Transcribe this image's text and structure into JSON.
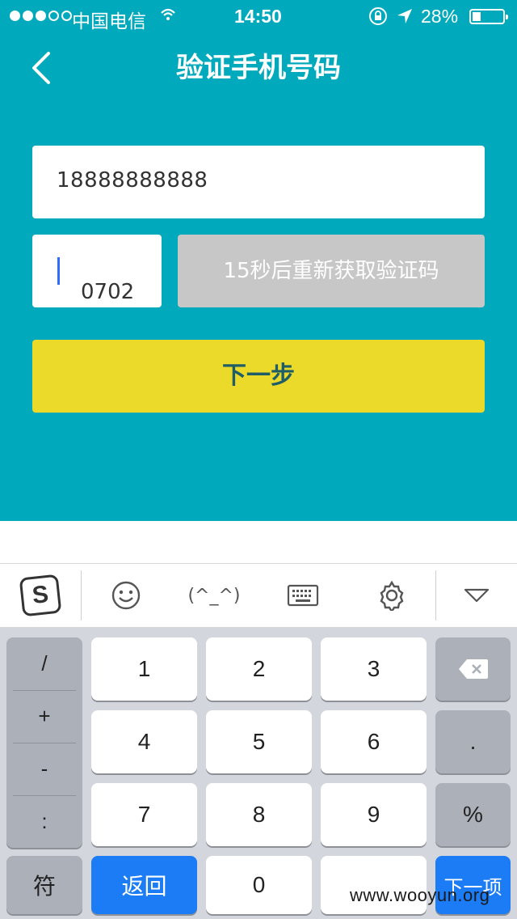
{
  "status_bar": {
    "carrier": "中国电信",
    "time": "14:50",
    "battery_percent": "28%",
    "battery_level": 0.28
  },
  "nav": {
    "title": "验证手机号码",
    "back_icon": "chevron-left-icon"
  },
  "form": {
    "phone_value": "18888888888",
    "code_value": "0702",
    "resend_label": "15秒后重新获取验证码",
    "next_label": "下一步"
  },
  "keyboard_toolbar": {
    "logo_letter": "S",
    "emoji_icon": "smiley-icon",
    "kaomoji": "(^_^)",
    "keyboard_icon": "keyboard-icon",
    "settings_icon": "gear-icon",
    "hide_icon": "triangle-down-icon"
  },
  "keyboard": {
    "symbols": [
      "/",
      "+",
      "-",
      ":"
    ],
    "digits": [
      "1",
      "2",
      "3",
      "4",
      "5",
      "6",
      "7",
      "8",
      "9"
    ],
    "delete_icon": "backspace-icon",
    "dot": ".",
    "percent": "%",
    "fu": "符",
    "back": "返回",
    "zero": "0",
    "next": "下一项"
  },
  "watermark": "www.wooyun.org",
  "colors": {
    "app_background": "#00a9bb",
    "next_button": "#ecda2a",
    "resend_button": "#c7c7c7",
    "key_blue": "#1b7cf5"
  }
}
